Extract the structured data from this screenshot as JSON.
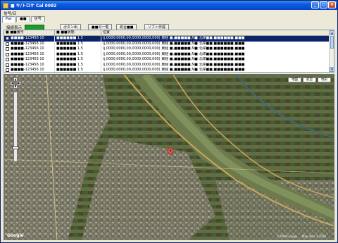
{
  "window": {
    "title": "■ キ/トロケ Cal 0082"
  },
  "menu": {
    "items": [
      "信号/日"
    ]
  },
  "tabs": [
    {
      "label": "Pwr"
    },
    {
      "label": "■■"
    },
    {
      "label": "信号"
    }
  ],
  "toolbar": {
    "status_label": "接続表示",
    "buttons": [
      "ボタン出",
      "■■の一覧",
      "総合■■",
      "ソフト作成"
    ]
  },
  "grid": {
    "columns": [
      "■ ■■番号",
      "■ ■■状態",
      "位置"
    ],
    "rows": [
      {
        "num": "■■■■-123456 10",
        "status": "■■■■■■ 1.5",
        "pos": "(j,0000,0000,00,0000,0000,000) 東経 ■,■■■■■,N■ 北緯■■,■■■■■■,■■■",
        "selected": true
      },
      {
        "num": "■■■■-123456 10",
        "status": "■■■■■■ 1.5",
        "pos": "(j,0000,0000,00,0000,0000,000) 東経 ■,■■■■■,N■ 北緯■■,■■■■■■,■■■",
        "selected": false
      },
      {
        "num": "■■■■-123456 10",
        "status": "■■■■■■ 1.5",
        "pos": "(j,0000,0000,00,0000,0000,000) 東経 ■,■■■■■,N■ 北緯■■,■■■■■■,■■■",
        "selected": false
      },
      {
        "num": "■■■■-123456 10",
        "status": "■■■■■■ 1.5",
        "pos": "(j,0000,0000,00,0000,0000,000) 東経 ■,■■■■■,N■ 北緯■■,■■■■■■,■■■",
        "selected": false
      },
      {
        "num": "■■■■-123456 10",
        "status": "■■■■■■ 1.5",
        "pos": "(j,0000,0000,00,0000,0000,000) 東経 ■,■■■■■,N■ 北緯■■,■■■■■■,■■■",
        "selected": false
      },
      {
        "num": "■■■■-123456 10",
        "status": "■■■■■■ 1.5",
        "pos": "(j,0000,0000,00,0000,0000,000) 東経 ■,■■■■■,N■ 北緯■■,■■■■■■,■■■",
        "selected": false
      },
      {
        "num": "■■■■-123456 10",
        "status": "■■■■■■ 1.5",
        "pos": "(j,0000,0000,00,0000,0000,000) 東経 ■,■■■■■,N■ 北緯■■,■■■■■■,■■■",
        "selected": false
      }
    ]
  },
  "map": {
    "type_buttons": [
      "地図",
      "航空",
      "地形"
    ],
    "copyright": "©2008 Google ... Map data ©2008 ...",
    "logo": "Google"
  },
  "colors": {
    "status_lamp": "#1e9b2d",
    "selection": "#0a246a",
    "titlebar": "#0a5be0"
  }
}
